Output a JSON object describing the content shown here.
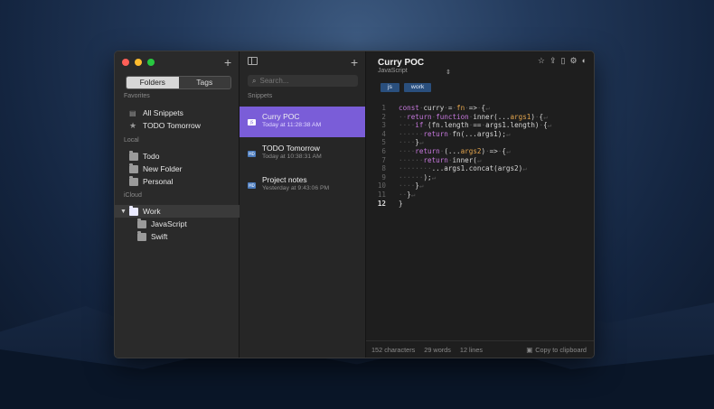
{
  "left": {
    "segments": [
      "Folders",
      "Tags"
    ],
    "sections": {
      "favorites": "Favorites",
      "local": "Local",
      "icloud": "iCloud"
    },
    "favorites": [
      "All Snippets",
      "TODO Tomorrow"
    ],
    "local": [
      "Todo",
      "New Folder",
      "Personal"
    ],
    "icloud": {
      "group": "Work",
      "children": [
        "JavaScript",
        "Swift"
      ]
    }
  },
  "mid": {
    "search_placeholder": "Search...",
    "section": "Snippets",
    "snippets": [
      {
        "title": "Curry POC",
        "time": "Today at 11:28:38 AM",
        "badge": "JS"
      },
      {
        "title": "TODO Tomorrow",
        "time": "Today at 10:38:31 AM",
        "badge": "MD"
      },
      {
        "title": "Project notes",
        "time": "Yesterday at 9:43:06 PM",
        "badge": "MD"
      }
    ]
  },
  "editor": {
    "title": "Curry POC",
    "language": "JavaScript",
    "tags": [
      "js",
      "work"
    ],
    "status": {
      "chars": "152 characters",
      "words": "29 words",
      "lines": "12 lines",
      "copy": "Copy to clipboard"
    }
  },
  "colors": {
    "accent": "#7a5dd8",
    "tag_bg": "#2a4f7d"
  },
  "icons": [
    "sidebar-toggle-icon",
    "star-icon",
    "share-icon",
    "export-icon",
    "gear-icon",
    "theme-icon",
    "search-icon",
    "clipboard-icon"
  ]
}
